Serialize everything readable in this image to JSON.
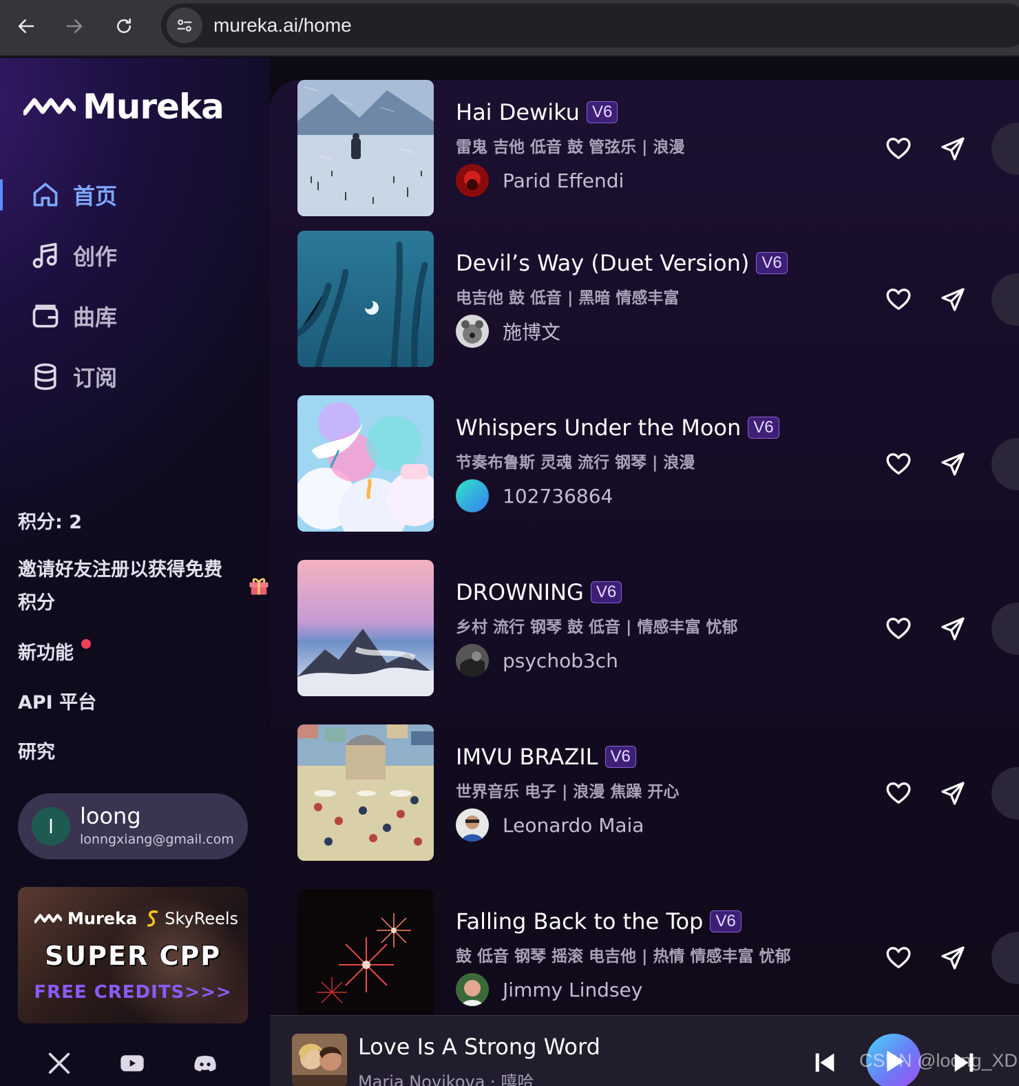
{
  "browser": {
    "url": "mureka.ai/home"
  },
  "sidebar": {
    "logo": "Mureka",
    "nav": [
      {
        "label": "首页",
        "icon": "home-icon",
        "active": true
      },
      {
        "label": "创作",
        "icon": "music-note-icon",
        "active": false
      },
      {
        "label": "曲库",
        "icon": "library-icon",
        "active": false
      },
      {
        "label": "订阅",
        "icon": "database-icon",
        "active": false
      }
    ],
    "credits": "积分: 2",
    "invite": "邀请好友注册以获得免费积分",
    "new_features": "新功能",
    "api": "API 平台",
    "research": "研究",
    "user": {
      "initial": "l",
      "name": "loong",
      "email": "lonngxiang@gmail.com"
    },
    "promo": {
      "brand": "Mureka",
      "partner": "SkyReels",
      "headline": "SUPER CPP",
      "cta": "FREE CREDITS>>>"
    }
  },
  "songs": [
    {
      "title": "Hai Dewiku",
      "version": "V6",
      "tags": "雷鬼 吉他 低音 鼓 管弦乐 | 浪漫",
      "author": "Parid Effendi"
    },
    {
      "title": "Devil’s Way (Duet Version)",
      "version": "V6",
      "tags": "电吉他 鼓 低音 | 黑暗 情感丰富",
      "author": "施博文"
    },
    {
      "title": "Whispers Under the Moon",
      "version": "V6",
      "tags": "节奏布鲁斯 灵魂 流行 钢琴 | 浪漫",
      "author": "102736864"
    },
    {
      "title": "DROWNING",
      "version": "V6",
      "tags": "乡村 流行 钢琴 鼓 低音 | 情感丰富 忧郁",
      "author": "psychob3ch"
    },
    {
      "title": "IMVU BRAZIL",
      "version": "V6",
      "tags": "世界音乐 电子 | 浪漫 焦躁 开心",
      "author": "Leonardo Maia"
    },
    {
      "title": "Falling Back to the Top",
      "version": "V6",
      "tags": "鼓 低音 钢琴 摇滚 电吉他 | 热情 情感丰富 忧郁",
      "author": "Jimmy Lindsey"
    }
  ],
  "player": {
    "title": "Love Is A Strong Word",
    "subtitle": "Maria Novikova · 嘻哈",
    "watermark": "CSDN @loong_XD"
  },
  "colors": {
    "accent": "#7fa7ff",
    "badge_bg": "#3d1f76",
    "badge_border": "#8b62d8",
    "notification_dot": "#f0405a"
  }
}
